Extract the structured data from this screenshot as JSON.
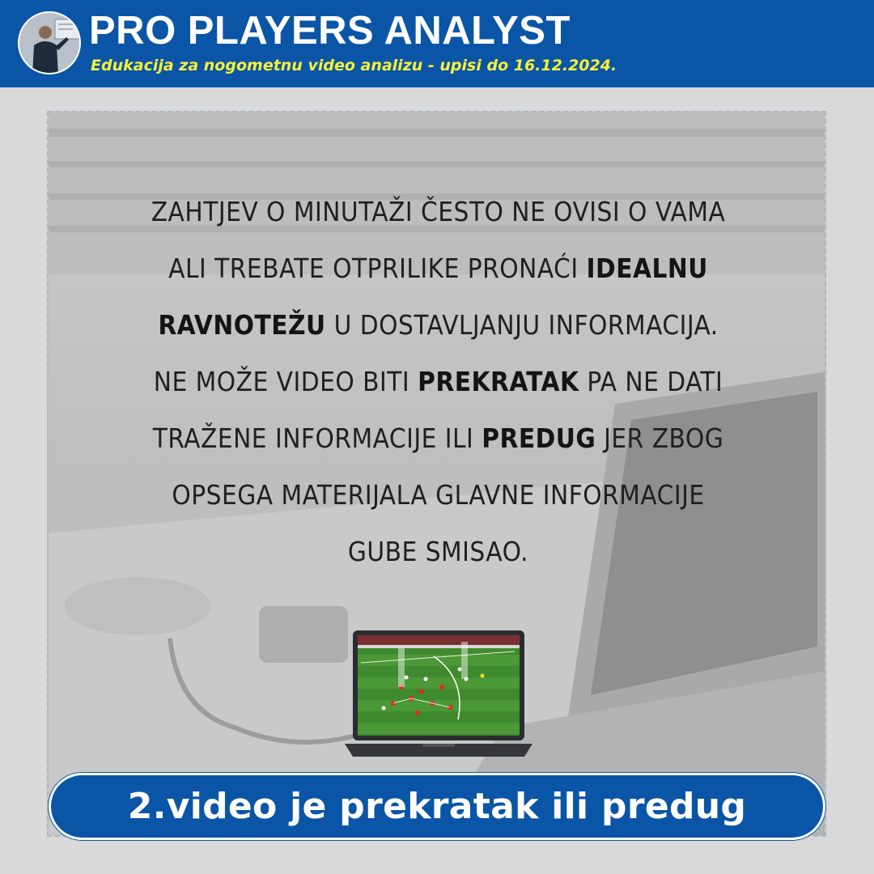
{
  "header": {
    "title": "PRO PLAYERS ANALYST",
    "subtitle": "Edukacija za nogometnu video analizu - upisi do 16.12.2024."
  },
  "quote": {
    "l1": "ZAHTJEV O MINUTAŽI ČESTO NE OVISI O VAMA",
    "l2a": "ALI TREBATE OTPRILIKE PRONAĆI ",
    "l2b": "IDEALNU",
    "l3a": "RAVNOTEŽU",
    "l3b": " U DOSTAVLJANJU INFORMACIJA.",
    "l4a": "NE MOŽE VIDEO BITI ",
    "l4b": "PREKRATAK",
    "l4c": " PA NE DATI",
    "l5a": "TRAŽENE INFORMACIJE ILI ",
    "l5b": "PREDUG",
    "l5c": " JER ZBOG",
    "l6": "OPSEGA MATERIJALA GLAVNE INFORMACIJE",
    "l7": "GUBE SMISAO."
  },
  "banner": {
    "text": "2.video je prekratak ili predug"
  },
  "colors": {
    "brand_blue": "#0a55a6",
    "subtitle_yellow": "#f7f03a",
    "pitch_green": "#3f8a2f"
  },
  "icons": {
    "avatar": "presenter-photo",
    "laptop": "laptop-with-tactical-video"
  }
}
